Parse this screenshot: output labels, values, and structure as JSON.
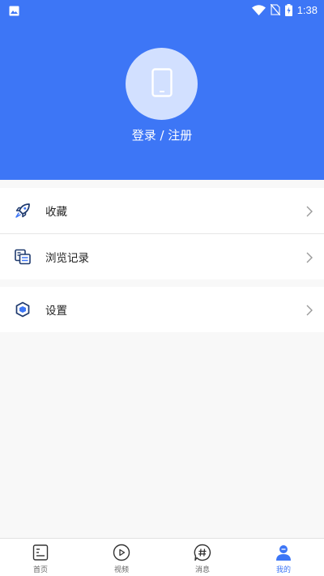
{
  "status_bar": {
    "time": "1:38",
    "icons": [
      "image-icon",
      "wifi-icon",
      "no-sim-icon",
      "battery-charging-icon"
    ]
  },
  "profile": {
    "avatar_icon": "phone-icon",
    "login_label": "登录 / 注册"
  },
  "menu": {
    "favorites": {
      "label": "收藏",
      "icon": "rocket-icon"
    },
    "history": {
      "label": "浏览记录",
      "icon": "history-icon"
    },
    "settings": {
      "label": "设置",
      "icon": "settings-hexagon-icon"
    }
  },
  "bottom_nav": {
    "items": [
      {
        "label": "首页",
        "icon": "home-doc-icon",
        "active": false
      },
      {
        "label": "视频",
        "icon": "play-circle-icon",
        "active": false
      },
      {
        "label": "消息",
        "icon": "message-hash-icon",
        "active": false
      },
      {
        "label": "我的",
        "icon": "user-icon",
        "active": true
      }
    ]
  },
  "colors": {
    "primary": "#3d76f6",
    "avatar_bg": "#d2e0ff",
    "background": "#f8f8f8",
    "icon_navy": "#1f3a6e"
  }
}
